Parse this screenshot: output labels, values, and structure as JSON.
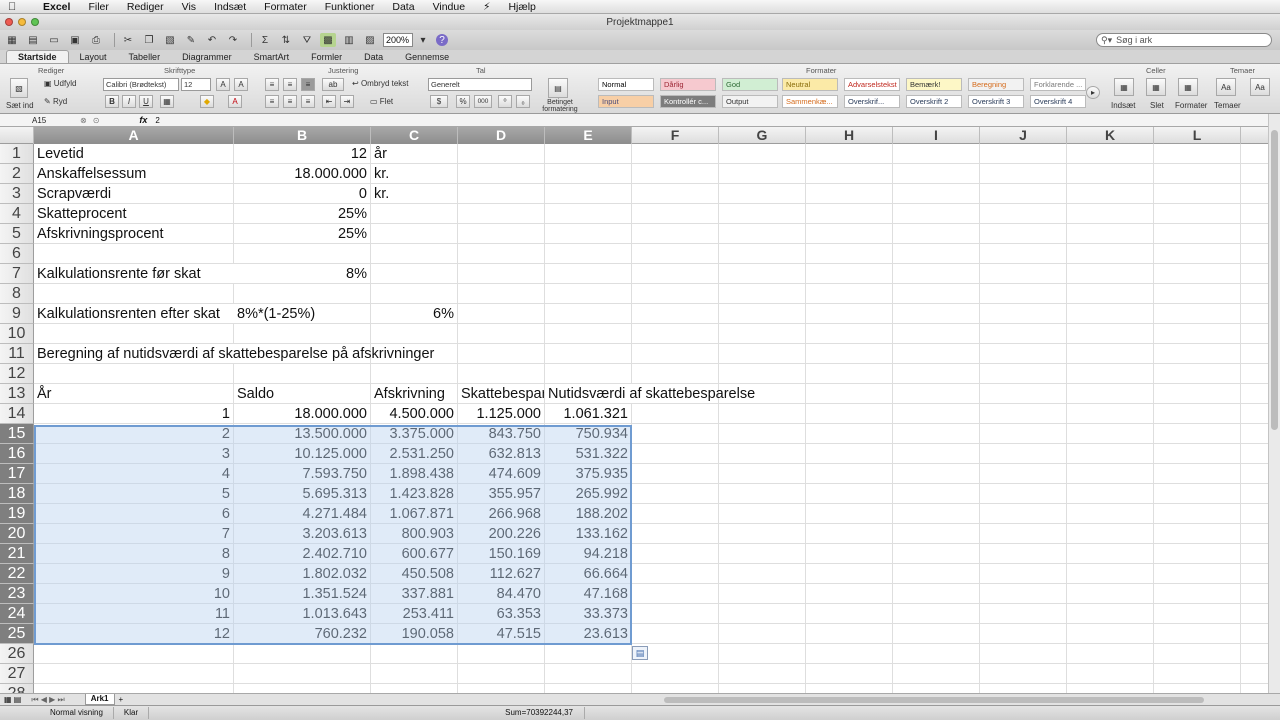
{
  "menu": [
    "Excel",
    "Filer",
    "Rediger",
    "Vis",
    "Indsæt",
    "Formater",
    "Funktioner",
    "Data",
    "Vindue",
    "Hjælp"
  ],
  "window_title": "Projektmappe1",
  "toolbar": {
    "zoom": "200%",
    "search_placeholder": "Søg i ark"
  },
  "ribbon_tabs": [
    "Startside",
    "Layout",
    "Tabeller",
    "Diagrammer",
    "SmartArt",
    "Formler",
    "Data",
    "Gennemse"
  ],
  "ribbon": {
    "groups": [
      "Rediger",
      "Skrifttype",
      "Justering",
      "Tal",
      "Formater",
      "Celler",
      "Temaer"
    ],
    "fill_label": "Udfyld",
    "clear_label": "Ryd",
    "paste_label": "Sæt ind",
    "font_name": "Calibri (Brødtekst)",
    "font_size": "12",
    "wrap_label": "Ombryd tekst",
    "merge_label": "Flet",
    "number_format": "Generelt",
    "cond_format_label": "Betinget formatering",
    "styles": [
      {
        "label": "Normal",
        "bg": "#ffffff",
        "fg": "#000000"
      },
      {
        "label": "Dårlig",
        "bg": "#f6c9cf",
        "fg": "#9c2533"
      },
      {
        "label": "God",
        "bg": "#d1eed3",
        "fg": "#2f6b35"
      },
      {
        "label": "Neutral",
        "bg": "#fbeaa7",
        "fg": "#8a6d0a"
      },
      {
        "label": "Advarselstekst",
        "bg": "#ffffff",
        "fg": "#c0281f"
      },
      {
        "label": "Bemærk!",
        "bg": "#fdf7c6",
        "fg": "#333333"
      },
      {
        "label": "Beregning",
        "bg": "#f2f2f2",
        "fg": "#d56b1b"
      },
      {
        "label": "Forklarende ...",
        "bg": "#ffffff",
        "fg": "#7a7a7a"
      },
      {
        "label": "Input",
        "bg": "#f8cfa6",
        "fg": "#4a4a7a"
      },
      {
        "label": "Kontrollér c...",
        "bg": "#7d7d7d",
        "fg": "#ffffff"
      },
      {
        "label": "Output",
        "bg": "#f2f2f2",
        "fg": "#333333"
      },
      {
        "label": "Sammenkæ...",
        "bg": "#ffffff",
        "fg": "#d56b1b"
      },
      {
        "label": "Overskrif...",
        "bg": "#ffffff",
        "fg": "#2a3c5a"
      },
      {
        "label": "Overskrift 2",
        "bg": "#ffffff",
        "fg": "#2a3c5a"
      },
      {
        "label": "Overskrift 3",
        "bg": "#ffffff",
        "fg": "#2a3c5a"
      },
      {
        "label": "Overskrift 4",
        "bg": "#ffffff",
        "fg": "#2a3c5a"
      }
    ],
    "insert_label": "Indsæt",
    "delete_label": "Slet",
    "format_label": "Formater",
    "themes_label": "Temaer"
  },
  "formula_bar": {
    "cell_ref": "A15",
    "value": "2"
  },
  "columns": [
    "A",
    "B",
    "C",
    "D",
    "E",
    "F",
    "G",
    "H",
    "I",
    "J",
    "K",
    "L"
  ],
  "rows": [
    {
      "n": "1",
      "A": "Levetid",
      "B": "12",
      "C": "år",
      "D": "",
      "E": ""
    },
    {
      "n": "2",
      "A": "Anskaffelsessum",
      "B": "18.000.000",
      "C": "kr.",
      "D": "",
      "E": ""
    },
    {
      "n": "3",
      "A": "Scrapværdi",
      "B": "0",
      "C": "kr.",
      "D": "",
      "E": ""
    },
    {
      "n": "4",
      "A": "Skatteprocent",
      "B": "25%",
      "C": "",
      "D": "",
      "E": ""
    },
    {
      "n": "5",
      "A": "Afskrivningsprocent",
      "B": "25%",
      "C": "",
      "D": "",
      "E": ""
    },
    {
      "n": "6",
      "A": "",
      "B": "",
      "C": "",
      "D": "",
      "E": ""
    },
    {
      "n": "7",
      "A": "Kalkulationsrente før skat",
      "B": "8%",
      "C": "",
      "D": "",
      "E": ""
    },
    {
      "n": "8",
      "A": "",
      "B": "",
      "C": "",
      "D": "",
      "E": ""
    },
    {
      "n": "9",
      "A": "Kalkulationsrenten efter skat",
      "B": "8%*(1-25%)",
      "C": "6%",
      "D": "",
      "E": ""
    },
    {
      "n": "10",
      "A": "",
      "B": "",
      "C": "",
      "D": "",
      "E": ""
    },
    {
      "n": "11",
      "A": "Beregning af nutidsværdi af skattebesparelse på afskrivninger",
      "B": "",
      "C": "",
      "D": "",
      "E": ""
    },
    {
      "n": "12",
      "A": "",
      "B": "",
      "C": "",
      "D": "",
      "E": ""
    },
    {
      "n": "13",
      "A": "År",
      "B": "Saldo",
      "C": "Afskrivning",
      "D": "Skattebespar",
      "E": "Nutidsværdi af skattebesparelse"
    },
    {
      "n": "14",
      "A": "1",
      "B": "18.000.000",
      "C": "4.500.000",
      "D": "1.125.000",
      "E": "1.061.321"
    },
    {
      "n": "15",
      "A": "2",
      "B": "13.500.000",
      "C": "3.375.000",
      "D": "843.750",
      "E": "750.934"
    },
    {
      "n": "16",
      "A": "3",
      "B": "10.125.000",
      "C": "2.531.250",
      "D": "632.813",
      "E": "531.322"
    },
    {
      "n": "17",
      "A": "4",
      "B": "7.593.750",
      "C": "1.898.438",
      "D": "474.609",
      "E": "375.935"
    },
    {
      "n": "18",
      "A": "5",
      "B": "5.695.313",
      "C": "1.423.828",
      "D": "355.957",
      "E": "265.992"
    },
    {
      "n": "19",
      "A": "6",
      "B": "4.271.484",
      "C": "1.067.871",
      "D": "266.968",
      "E": "188.202"
    },
    {
      "n": "20",
      "A": "7",
      "B": "3.203.613",
      "C": "800.903",
      "D": "200.226",
      "E": "133.162"
    },
    {
      "n": "21",
      "A": "8",
      "B": "2.402.710",
      "C": "600.677",
      "D": "150.169",
      "E": "94.218"
    },
    {
      "n": "22",
      "A": "9",
      "B": "1.802.032",
      "C": "450.508",
      "D": "112.627",
      "E": "66.664"
    },
    {
      "n": "23",
      "A": "10",
      "B": "1.351.524",
      "C": "337.881",
      "D": "84.470",
      "E": "47.168"
    },
    {
      "n": "24",
      "A": "11",
      "B": "1.013.643",
      "C": "253.411",
      "D": "63.353",
      "E": "33.373"
    },
    {
      "n": "25",
      "A": "12",
      "B": "760.232",
      "C": "190.058",
      "D": "47.515",
      "E": "23.613"
    },
    {
      "n": "26",
      "A": "",
      "B": "",
      "C": "",
      "D": "",
      "E": ""
    },
    {
      "n": "27",
      "A": "",
      "B": "",
      "C": "",
      "D": "",
      "E": ""
    },
    {
      "n": "28",
      "A": "",
      "B": "",
      "C": "",
      "D": "",
      "E": ""
    }
  ],
  "selected_rows": [
    "15",
    "16",
    "17",
    "18",
    "19",
    "20",
    "21",
    "22",
    "23",
    "24",
    "25"
  ],
  "selected_cols": [
    "A",
    "B",
    "C",
    "D",
    "E"
  ],
  "sheet_tab": "Ark1",
  "status": {
    "view": "Normal visning",
    "ready": "Klar",
    "sum": "Sum=70392244,37"
  }
}
